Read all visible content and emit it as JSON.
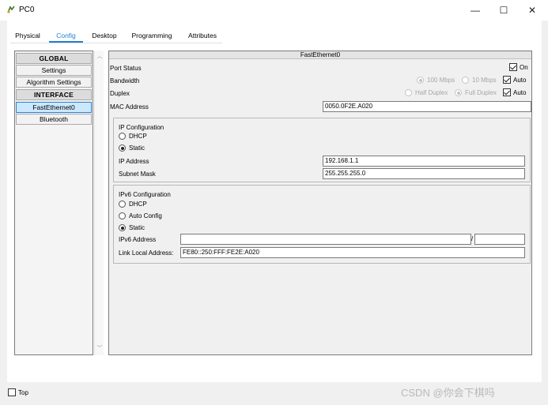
{
  "window": {
    "title": "PC0",
    "minimize": "—",
    "maximize": "☐",
    "close": "✕"
  },
  "tabs": [
    {
      "label": "Physical"
    },
    {
      "label": "Config",
      "active": true
    },
    {
      "label": "Desktop"
    },
    {
      "label": "Programming"
    },
    {
      "label": "Attributes"
    }
  ],
  "sidebar": {
    "items": [
      {
        "label": "GLOBAL",
        "type": "header"
      },
      {
        "label": "Settings"
      },
      {
        "label": "Algorithm Settings"
      },
      {
        "label": "INTERFACE",
        "type": "header"
      },
      {
        "label": "FastEthernet0",
        "selected": true
      },
      {
        "label": "Bluetooth"
      }
    ],
    "scroll_up": "︿",
    "scroll_down": "﹀"
  },
  "panel": {
    "title": "FastEthernet0",
    "port_status": {
      "label": "Port Status",
      "on_label": "On",
      "on_checked": true
    },
    "bandwidth": {
      "label": "Bandwidth",
      "options": [
        "100 Mbps",
        "10 Mbps"
      ],
      "auto_label": "Auto",
      "auto_checked": true
    },
    "duplex": {
      "label": "Duplex",
      "options": [
        "Half Duplex",
        "Full Duplex"
      ],
      "auto_label": "Auto",
      "auto_checked": true
    },
    "mac": {
      "label": "MAC Address",
      "value": "0050.0F2E.A020"
    },
    "ip_config": {
      "title": "IP Configuration",
      "dhcp_label": "DHCP",
      "static_label": "Static",
      "mode": "Static",
      "ip_label": "IP Address",
      "ip_value": "192.168.1.1",
      "mask_label": "Subnet Mask",
      "mask_value": "255.255.255.0"
    },
    "ipv6_config": {
      "title": "IPv6 Configuration",
      "dhcp_label": "DHCP",
      "auto_label": "Auto Config",
      "static_label": "Static",
      "mode": "Static",
      "addr_label": "IPv6 Address",
      "addr_value": "",
      "prefix_sep": "/",
      "prefix_value": "",
      "link_local_label": "Link Local Address:",
      "link_local_value": "FE80::250:FFF:FE2E:A020"
    }
  },
  "footer": {
    "top_label": "Top",
    "top_checked": false,
    "watermark": "CSDN @你会下棋吗"
  },
  "colors": {
    "accent": "#1e7fd6",
    "selected_bg": "#cce8ff"
  }
}
